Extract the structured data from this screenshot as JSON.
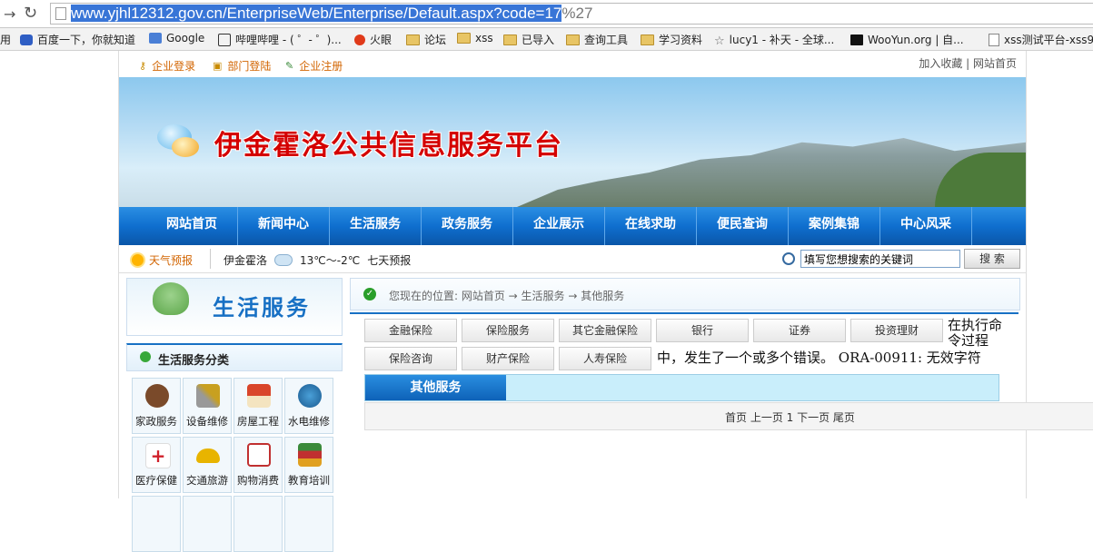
{
  "browser": {
    "url_selected": "www.yjhl12312.gov.cn/EnterpriseWeb/Enterprise/Default.aspx?code=17",
    "url_rest": "%27",
    "bookmarks": [
      "用",
      "百度一下，你就知道",
      "Google",
      "哔哩哔哩 - ( ゜- ゜)...",
      "火眼",
      "论坛",
      "xss",
      "已导入",
      "查询工具",
      "学习资料",
      "lucy1 - 补天 - 全球...",
      "WooYun.org | 自...",
      "xss测试平台-xss9"
    ]
  },
  "site": {
    "top_links": [
      "企业登录",
      "部门登陆",
      "企业注册"
    ],
    "top_right": "加入收藏 | 网站首页",
    "title": "伊金霍洛公共信息服务平台",
    "nav": [
      "网站首页",
      "新闻中心",
      "生活服务",
      "政务服务",
      "企业展示",
      "在线求助",
      "便民查询",
      "案例集锦",
      "中心风采"
    ],
    "weather": {
      "label": "天气预报",
      "city": "伊金霍洛",
      "temp": "13℃～-2℃",
      "forecast": "七天预报"
    },
    "search": {
      "placeholder": "填写您想搜索的关键词",
      "button": "搜 索"
    }
  },
  "sidebar": {
    "banner_title": "生活服务",
    "category_title": "生活服务分类",
    "items": [
      {
        "label": "家政服务",
        "icon": "housekeeper-icon",
        "color": "#7a4a2a"
      },
      {
        "label": "设备维修",
        "icon": "tools-icon",
        "color": "#8a8a8a"
      },
      {
        "label": "房屋工程",
        "icon": "house-icon",
        "color": "#d9452a"
      },
      {
        "label": "水电维修",
        "icon": "faucet-icon",
        "color": "#2a7ab0"
      },
      {
        "label": "医疗保健",
        "icon": "medical-cross-icon",
        "color": "#d0202a"
      },
      {
        "label": "交通旅游",
        "icon": "car-icon",
        "color": "#e8b400"
      },
      {
        "label": "购物消费",
        "icon": "shopping-cart-icon",
        "color": "#c03030"
      },
      {
        "label": "教育培训",
        "icon": "books-icon",
        "color": "#3a8a3a"
      }
    ]
  },
  "main": {
    "breadcrumb": "您现在的位置: 网站首页 → 生活服务 → 其他服务",
    "subtabs_row1": [
      "金融保险",
      "保险服务",
      "其它金融保险",
      "银行",
      "证券",
      "投资理财"
    ],
    "subtabs_row2": [
      "保险咨询",
      "财产保险",
      "人寿保险"
    ],
    "error_line1": "在执行命",
    "error_line2": "令过程",
    "error_line3": "中，发生了一个或多个错误。 ORA-00911: 无效字符",
    "active_tab": "其他服务",
    "pager": "首页 上一页 1 下一页 尾页"
  }
}
